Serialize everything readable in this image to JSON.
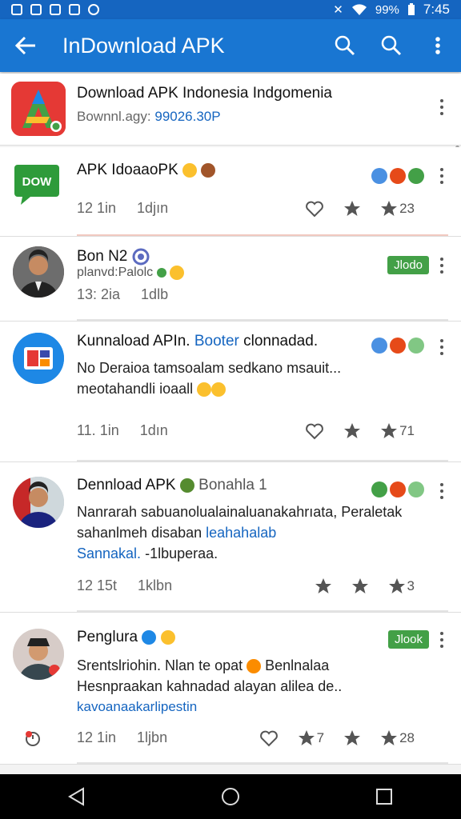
{
  "status_bar": {
    "battery_text": "99%",
    "time": "7:45"
  },
  "app_bar": {
    "title": "InDownload APK",
    "actions": [
      "search-icon",
      "search-icon",
      "more-vert-icon"
    ]
  },
  "header": {
    "title": "Download APK Indonesia Indgomenia",
    "subtitle_label": "Bownnl.agy:",
    "subtitle_value": "99026.30P"
  },
  "posts": [
    {
      "title": "APK IdoaaoPK",
      "meta_a": "12 1in",
      "meta_b": "1djın",
      "actions": [
        "",
        "",
        "23"
      ]
    },
    {
      "title": "Bon N2",
      "subtitle": "planvd:Palolc",
      "meta_a": "13: 2ia",
      "meta_b": "1dlb",
      "button": "Jlodo"
    },
    {
      "title_a": "Kunnaload APIn.",
      "title_b": "Booter",
      "title_c": "clonnadad.",
      "line1": "No Deraioa tamsoalam sedkano msauit...",
      "line2": "meotahandli ioaall",
      "meta_a": "11. 1in",
      "meta_b": "1dın",
      "actions": [
        "",
        "",
        "71"
      ]
    },
    {
      "title": "Dennload APK",
      "title_extra": "Bonahla 1",
      "line1": "Nanrarah sabuanolualainaluanakahrıata, Peraletak",
      "line2_a": "sahanlmeh disaban",
      "line2_b": "leahahalab",
      "line3_a": "Sannakal.",
      "line3_b": "-1lbuperaa.",
      "meta_a": "12 15t",
      "meta_b": "1klbn",
      "actions": [
        "",
        "",
        "3"
      ]
    },
    {
      "title": "Penglura",
      "line1": "Srentslriohin. Nlan te opat",
      "line1_b": "Benlnalaa",
      "line2": "Hesnpraakan kahnadad alayan alilea de..",
      "line3": "kavoanaakarlipestin",
      "meta_a": "12 1in",
      "meta_b": "1ljbn",
      "button": "Jlook",
      "actions": [
        "",
        "7",
        "28"
      ]
    }
  ],
  "nav_bar": [
    "back-triangle-icon",
    "home-circle-icon",
    "recents-square-icon"
  ],
  "colors": {
    "primary": "#1976d2",
    "status": "#1565c0",
    "green": "#43a047",
    "link": "#1565c0"
  }
}
